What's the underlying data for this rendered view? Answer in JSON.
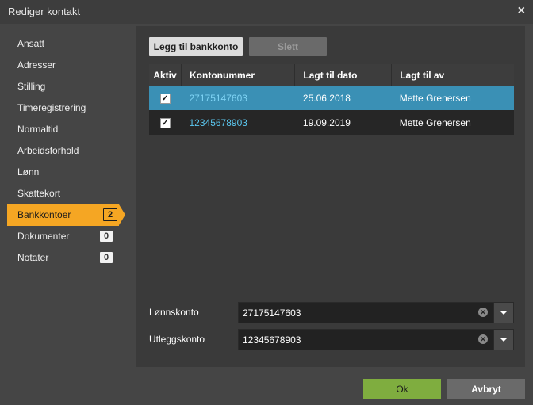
{
  "window": {
    "title": "Rediger kontakt",
    "close_label": "×"
  },
  "sidebar": {
    "items": [
      {
        "label": "Ansatt"
      },
      {
        "label": "Adresser"
      },
      {
        "label": "Stilling"
      },
      {
        "label": "Timeregistrering"
      },
      {
        "label": "Normaltid"
      },
      {
        "label": "Arbeidsforhold"
      },
      {
        "label": "Lønn"
      },
      {
        "label": "Skattekort"
      },
      {
        "label": "Bankkontoer",
        "badge": "2",
        "active": true
      },
      {
        "label": "Dokumenter",
        "badge": "0"
      },
      {
        "label": "Notater",
        "badge": "0"
      }
    ]
  },
  "toolbar": {
    "add_label": "Legg til bankkonto",
    "delete_label": "Slett"
  },
  "grid": {
    "columns": [
      "Aktiv",
      "Kontonummer",
      "Lagt til dato",
      "Lagt til av"
    ],
    "rows": [
      {
        "active": true,
        "account": "27175147603",
        "date": "25.06.2018",
        "by": "Mette Grenersen",
        "selected": true
      },
      {
        "active": true,
        "account": "12345678903",
        "date": "19.09.2019",
        "by": "Mette Grenersen",
        "selected": false
      }
    ]
  },
  "form": {
    "salary_label": "Lønnskonto",
    "salary_value": "27175147603",
    "expense_label": "Utleggskonto",
    "expense_value": "12345678903"
  },
  "footer": {
    "ok_label": "Ok",
    "cancel_label": "Avbryt"
  },
  "colors": {
    "accent": "#f5a623",
    "selected_row": "#3a90b5",
    "ok_button": "#7fad3f",
    "link": "#5bc6ee"
  }
}
